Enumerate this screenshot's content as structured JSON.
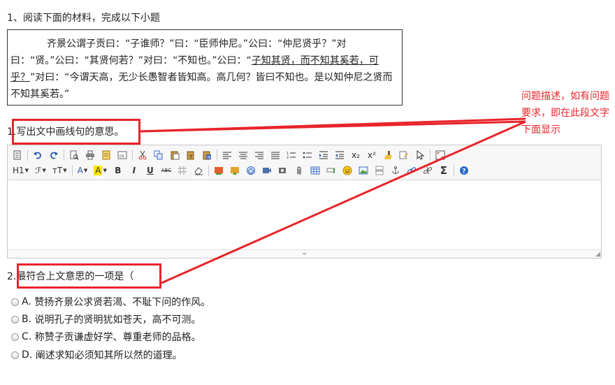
{
  "question": {
    "title": "1、阅读下面的材料，完成以下小题",
    "passage": {
      "part1": "齐景公谓子贡曰：“子谁师？”曰：“臣师仲尼。”公曰：“仲尼贤乎？”对曰：“贤。”公曰：“其贤何若？”对曰：“不知也。”公曰：“",
      "underlined": "子知其贤，而不知其奚若，可乎？",
      "part2": "”对曰：“今谓天高，无少长愚智者皆知高。高几何？皆曰不知也。是以知仲尼之贤而不知其奚若。”"
    }
  },
  "sub1": {
    "number": "1.",
    "text": "写出文中画线句的意思。"
  },
  "sub2": {
    "number": "2.",
    "text": "最符合上文意思的一项是（"
  },
  "toolbar": {
    "heading": "H1",
    "font_family": "ℱ",
    "font_size": "тT",
    "font_color": "A",
    "highlight": "A",
    "bold": "B",
    "italic": "I",
    "underline": "U",
    "strikethrough": "ABC",
    "subscript": "x₂",
    "superscript": "x²",
    "formula": "Σ",
    "help": "?"
  },
  "options": [
    {
      "label": "A.",
      "text": "赞扬齐景公求贤若渴、不耻下问的作风。"
    },
    {
      "label": "B.",
      "text": "说明孔子的贤明犹如苍天，高不可测。"
    },
    {
      "label": "C.",
      "text": "称赞子贡谦虚好学、尊重老师的品格。"
    },
    {
      "label": "D.",
      "text": "阐述求知必须知其所以然的道理。"
    }
  ],
  "annotation": {
    "text": "问题描述，如有问题要求，即在此段文字下面显示"
  },
  "colors": {
    "annotation_red": "#e8242b",
    "editor_border": "#c8c8c8",
    "toolbar_bg": "#f7f7f7"
  }
}
